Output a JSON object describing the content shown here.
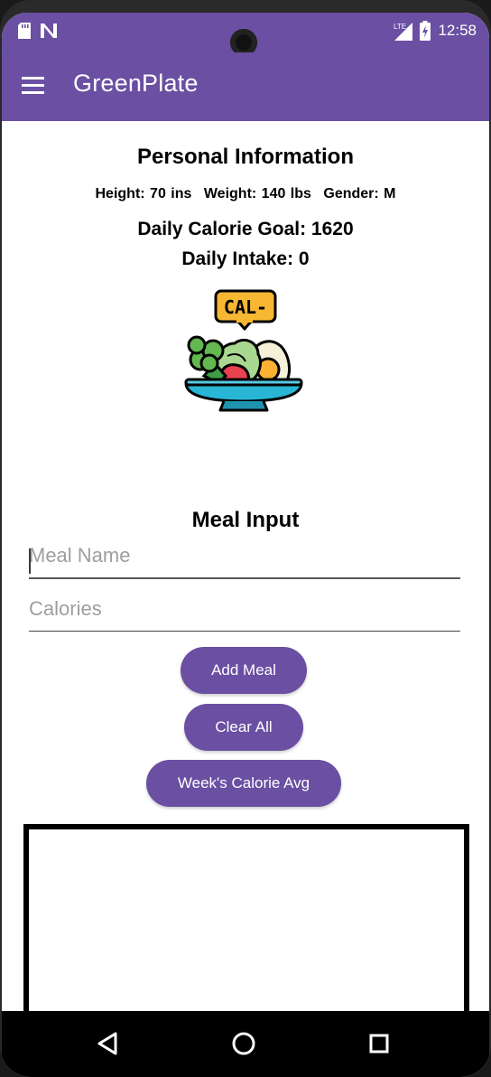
{
  "status_bar": {
    "time": "12:58",
    "network": "LTE"
  },
  "app_bar": {
    "title": "GreenPlate",
    "menu_icon": "hamburger-menu-icon"
  },
  "personal": {
    "heading": "Personal Information",
    "height": "Height: 70 ins",
    "weight": "Weight: 140 lbs",
    "gender": "Gender: M",
    "goal": "Daily Calorie Goal: 1620",
    "intake": "Daily Intake: 0"
  },
  "illustration": {
    "badge_text": "CAL-",
    "icon": "salad-bowl-icon"
  },
  "meal_input": {
    "heading": "Meal Input",
    "meal_name_placeholder": "Meal Name",
    "meal_name_value": "",
    "calories_placeholder": "Calories",
    "calories_value": ""
  },
  "buttons": {
    "add_meal": "Add Meal",
    "clear_all": "Clear All",
    "week_avg": "Week's Calorie Avg"
  },
  "colors": {
    "primary": "#6a4fa2",
    "badge": "#f7b733",
    "bowl": "#29b6d6"
  },
  "nav": {
    "back_icon": "back-triangle-icon",
    "home_icon": "home-circle-icon",
    "recents_icon": "recents-square-icon"
  }
}
